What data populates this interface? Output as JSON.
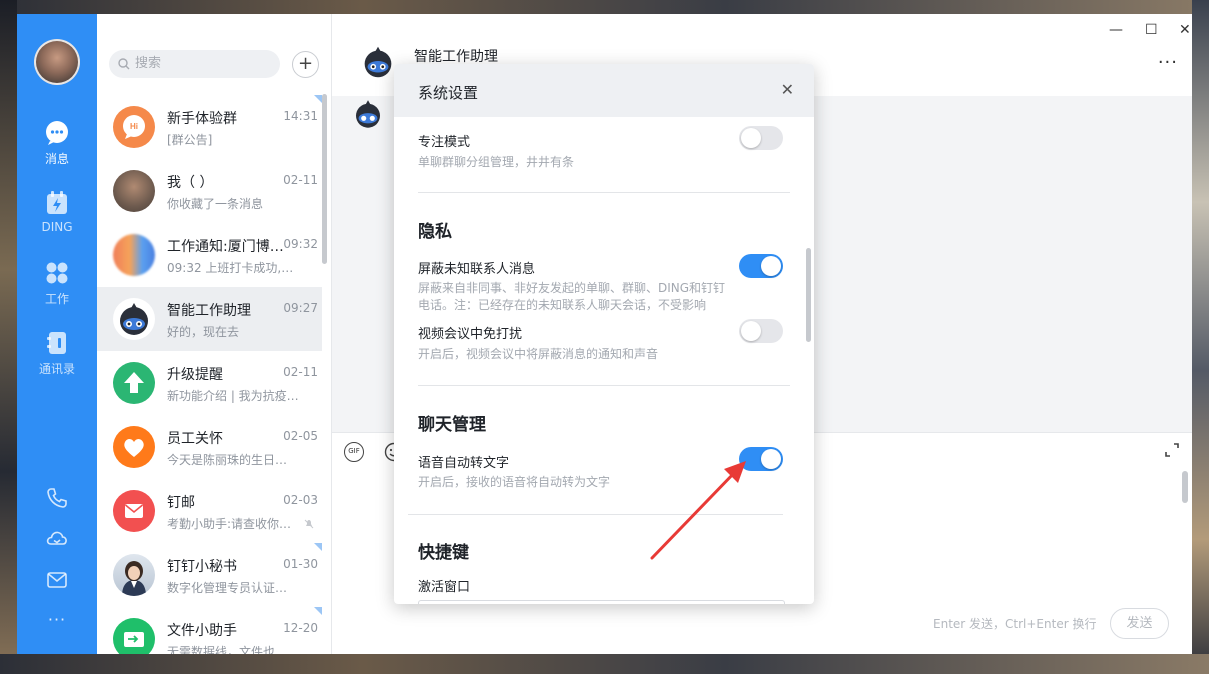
{
  "colors": {
    "primary": "#2f8ef5",
    "arrow": "#e83a36"
  },
  "nav": {
    "items": [
      {
        "label": "消息",
        "icon": "chat-bubble-icon"
      },
      {
        "label": "DING",
        "icon": "ding-icon"
      },
      {
        "label": "工作",
        "icon": "apps-grid-icon"
      },
      {
        "label": "通讯录",
        "icon": "contacts-icon"
      }
    ],
    "bottom_icons": [
      "phone-icon",
      "cloud-icon",
      "mail-icon",
      "more-icon"
    ],
    "more_label": "···"
  },
  "list": {
    "search_placeholder": "搜索",
    "add_label": "+",
    "conversations": [
      {
        "name": "新手体验群",
        "time": "14:31",
        "preview": "[群公告]",
        "avatar": "group-avatar"
      },
      {
        "name": "我（ ）",
        "time": "02-11",
        "preview": "你收藏了一条消息",
        "avatar": "user-avatar"
      },
      {
        "name": "工作通知:厦门博…",
        "time": "09:32",
        "preview": "09:32 上班打卡成功,…",
        "avatar": "work-notice-avatar"
      },
      {
        "name": "智能工作助理",
        "time": "09:27",
        "preview": "好的，现在去",
        "avatar": "assistant-avatar"
      },
      {
        "name": "升级提醒",
        "time": "02-11",
        "preview": "新功能介绍 | 我为抗疫…",
        "avatar": "upgrade-avatar"
      },
      {
        "name": "员工关怀",
        "time": "02-05",
        "preview": "今天是陈丽珠的生日…",
        "avatar": "care-avatar"
      },
      {
        "name": "钉邮",
        "time": "02-03",
        "preview": "考勤小助手:请查收你…",
        "avatar": "mail-avatar"
      },
      {
        "name": "钉钉小秘书",
        "time": "01-30",
        "preview": "数字化管理专员认证…",
        "avatar": "secretary-avatar"
      },
      {
        "name": "文件小助手",
        "time": "12-20",
        "preview": "无需数据线，文件也…",
        "avatar": "file-avatar"
      }
    ]
  },
  "chat": {
    "title": "智能工作助理",
    "window_controls": [
      "—",
      "☐",
      "✕"
    ],
    "more": "···",
    "send_hint": "Enter 发送，Ctrl+Enter 换行",
    "send_label": "发送",
    "gif_label": "GIF"
  },
  "dialog": {
    "title": "系统设置",
    "close": "✕",
    "focus": {
      "title": "专注模式",
      "desc": "单聊群聊分组管理，井井有条",
      "on": false
    },
    "privacy": {
      "heading": "隐私",
      "block_unknown": {
        "title": "屏蔽未知联系人消息",
        "desc": "屏蔽来自非同事、非好友发起的单聊、群聊、DING和钉钉电话。注：已经存在的未知联系人聊天会话，不受影响",
        "on": true
      },
      "meeting_dnd": {
        "title": "视频会议中免打扰",
        "desc": "开启后，视频会议中将屏蔽消息的通知和声音",
        "on": false
      }
    },
    "chat_mgmt": {
      "heading": "聊天管理",
      "voice_to_text": {
        "title": "语音自动转文字",
        "desc": "开启后，接收的语音将自动转为文字",
        "on": true
      }
    },
    "shortcuts": {
      "heading": "快捷键",
      "activate": "激活窗口"
    }
  }
}
